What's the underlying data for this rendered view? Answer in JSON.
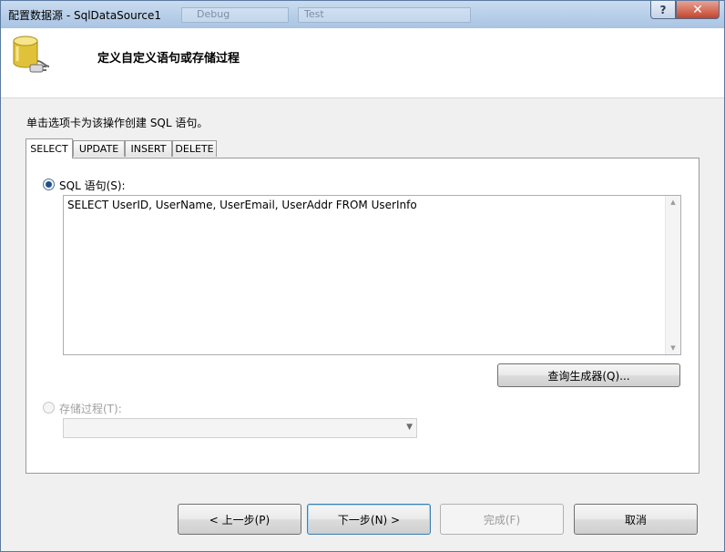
{
  "window": {
    "title": "配置数据源 - SqlDataSource1",
    "ghost_items": [
      "Debug",
      "Test"
    ],
    "help_glyph": "?",
    "close_glyph": "✕"
  },
  "header": {
    "heading": "定义自定义语句或存储过程",
    "icon": "database-connection-icon"
  },
  "instruction": "单击选项卡为该操作创建 SQL 语句。",
  "tabs": [
    {
      "label": "SELECT",
      "active": true
    },
    {
      "label": "UPDATE",
      "active": false
    },
    {
      "label": "INSERT",
      "active": false
    },
    {
      "label": "DELETE",
      "active": false
    }
  ],
  "sql_option": {
    "label": "SQL 语句(S):",
    "selected": true,
    "value": "SELECT UserID, UserName, UserEmail, UserAddr FROM UserInfo"
  },
  "query_builder_label": "查询生成器(Q)...",
  "sproc_option": {
    "label": "存储过程(T):",
    "selected": false,
    "value": ""
  },
  "footer": {
    "back_label": "< 上一步(P)",
    "next_label": "下一步(N) >",
    "finish_label": "完成(F)",
    "cancel_label": "取消"
  },
  "colors": {
    "title_bar": "#b9d1ea",
    "close_button": "#c4452c",
    "focus_border": "#3c7fb1"
  }
}
